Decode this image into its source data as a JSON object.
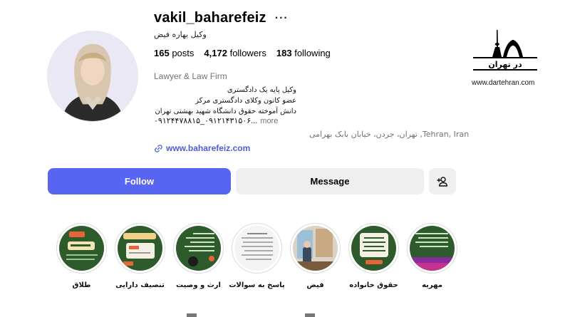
{
  "profile": {
    "username": "vakil_baharefeiz",
    "more_glyph": "···",
    "display_name": "وکیل بهاره فیض",
    "stats": {
      "posts_count": "165",
      "posts_label": "posts",
      "followers_count": "4,172",
      "followers_label": "followers",
      "following_count": "183",
      "following_label": "following"
    },
    "category": "Lawyer & Law Firm",
    "bio_lines": [
      "وکیل پایه یک دادگستری",
      "عضو کانون وکلای دادگستری مرکز",
      "دانش آموخته حقوق دانشگاه شهید بهشتی تهران"
    ],
    "phone_line": "۰۹۱۲۴۴۷۸۸۱۵_۰۹۱۲۱۴۳۱۵۰۶...",
    "more_label": "more",
    "address": "تهران، جردن، خیابان بابک بهرامی ,Tehran, Iran",
    "website": "www.baharefeiz.com"
  },
  "actions": {
    "follow_label": "Follow",
    "message_label": "Message",
    "add_user_icon": "person-add-icon"
  },
  "brand": {
    "logo_text": "در تهران",
    "url": "www.dartehran.com"
  },
  "highlights": [
    {
      "label": "طلاق",
      "icon": "highlight-cover",
      "bg": "#2e5b2b"
    },
    {
      "label": "تنصیف دارایی",
      "icon": "highlight-cover",
      "bg": "#2e5b2b"
    },
    {
      "label": "ارث و وصیت",
      "icon": "highlight-cover",
      "bg": "#2e5b2b"
    },
    {
      "label": "پاسخ به سوالات",
      "icon": "highlight-cover",
      "bg": "#f4f4f4"
    },
    {
      "label": "فیض",
      "icon": "highlight-cover",
      "bg": "#d9d2c5"
    },
    {
      "label": "حقوق خانواده",
      "icon": "highlight-cover",
      "bg": "#2e5b2b"
    },
    {
      "label": "مهریه",
      "icon": "highlight-cover",
      "bg": "#2e5b2b"
    }
  ],
  "colors": {
    "accent": "#5865f2",
    "link": "#4f5bd5",
    "muted": "#737373",
    "button_bg": "#efefef"
  }
}
